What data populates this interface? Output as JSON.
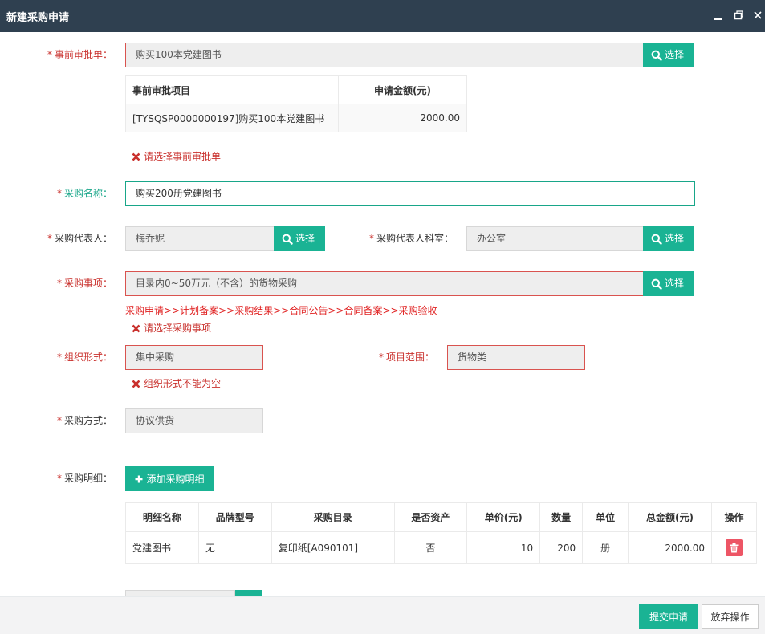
{
  "window": {
    "title": "新建采购申请"
  },
  "form": {
    "pre_approval": {
      "label": "事前审批单：",
      "value": "购买100本党建图书",
      "select_label": "选择",
      "table": {
        "headers": [
          "事前审批项目",
          "申请金额(元)"
        ],
        "rows": [
          [
            "[TYSQSP0000000197]购买100本党建图书",
            "2000.00"
          ]
        ]
      },
      "error": "请选择事前审批单"
    },
    "purchase_name": {
      "label": "采购名称：",
      "value": "购买200册党建图书"
    },
    "representative": {
      "label": "采购代表人：",
      "value": "梅乔妮",
      "select_label": "选择"
    },
    "rep_department": {
      "label": "采购代表人科室：",
      "value": "办公室",
      "select_label": "选择"
    },
    "purchase_item": {
      "label": "采购事项：",
      "value": "目录内0~50万元（不含）的货物采购",
      "select_label": "选择",
      "flow": "采购申请>>计划备案>>采购结果>>合同公告>>合同备案>>采购验收",
      "error": "请选择采购事项"
    },
    "org_form": {
      "label": "组织形式：",
      "value": "集中采购",
      "error": "组织形式不能为空"
    },
    "project_scope": {
      "label": "项目范围：",
      "value": "货物类"
    },
    "purchase_method": {
      "label": "采购方式：",
      "value": "协议供货"
    },
    "details": {
      "label": "采购明细：",
      "add_label": "添加采购明细",
      "headers": [
        "明细名称",
        "品牌型号",
        "采购目录",
        "是否资产",
        "单价(元)",
        "数量",
        "单位",
        "总金额(元)",
        "操作"
      ],
      "rows": [
        {
          "name": "党建图书",
          "brand": "无",
          "catalog": "复印纸[A090101]",
          "is_asset": "否",
          "unit_price": "10",
          "qty": "200",
          "unit": "册",
          "total": "2000.00"
        }
      ]
    }
  },
  "footer": {
    "submit": "提交申请",
    "cancel": "放弃操作"
  },
  "colors": {
    "titlebar": "#2f4050",
    "accent": "#1ab394",
    "error": "#c9302c",
    "danger": "#ed5565"
  }
}
